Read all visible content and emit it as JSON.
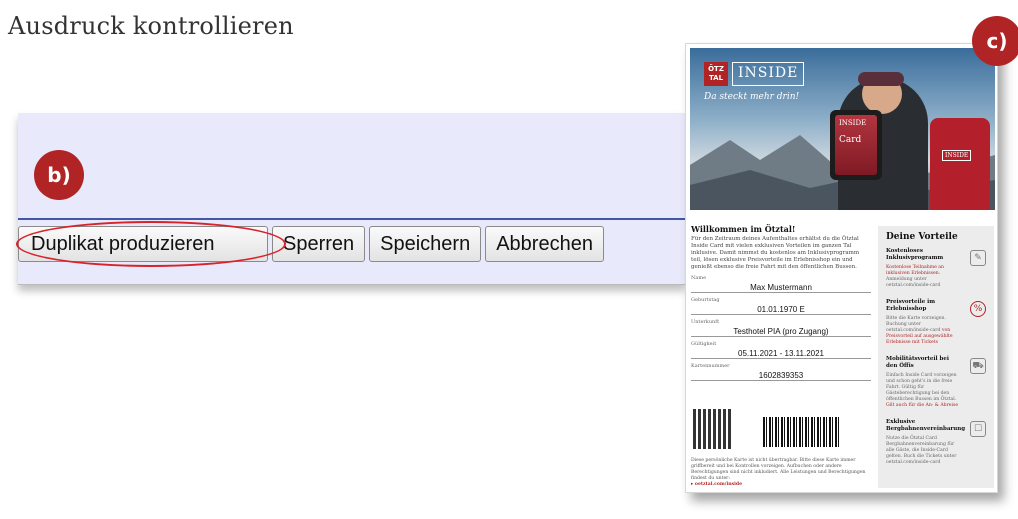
{
  "title": "Ausdruck kontrollieren",
  "badges": {
    "b": "b)",
    "c": "c)"
  },
  "buttons": {
    "duplicate": "Duplikat produzieren",
    "lock": "Sperren",
    "save": "Speichern",
    "cancel": "Abbrechen"
  },
  "colors": {
    "highlight": "#d8232a",
    "badge": "#b02425",
    "panel": "#e8eafb",
    "divider": "#4456a8"
  },
  "card": {
    "logo": "ÖTZ TAL",
    "brand": "INSIDE",
    "tagline": "Da steckt mehr drin!",
    "phone_card_brand": "INSIDE",
    "phone_card_label": "Card",
    "bag_label": "INSIDE",
    "welcome": "Willkommen im Ötztal!",
    "intro": "Für den Zeitraum deines Aufenthaltes erhältst du die Ötztal Inside Card mit vielen exklusiven Vorteilen im ganzen Tal inklusive. Damit nimmst du kostenlos am Inklusivprogramm teil, lösen exklusive Preisvorteile im Erlebnisshop ein und genießt ebenso die freie Fahrt mit den öffentlichen Bussen.",
    "fields": [
      {
        "label": "Name",
        "value": "Max Mustermann"
      },
      {
        "label": "Geburtstag",
        "value": "01.01.1970   E"
      },
      {
        "label": "Unterkunft",
        "value": "Testhotel PIA (pro Zugang)"
      },
      {
        "label": "Gültigkeit",
        "value": "05.11.2021 - 13.11.2021"
      },
      {
        "label": "Kartennummer",
        "value": "1602839353"
      }
    ],
    "footer": "Diese persönliche Karte ist nicht übertragbar. Bitte diese Karte immer griffbereit und bei Kontrollen vorzeigen. Aufbuchen oder andere Berechtigungen sind nicht inkludiert. Alle Leistungen und Berechtigungen findest du unter:",
    "footer_link": "▸ oetztal.com/inside",
    "advantages_title": "Deine Vorteile",
    "advantages": [
      {
        "title": "Kostenloses Inklusivprogramm",
        "desc_red": "Kostenlose Teilnahme an inklusiven Erlebnissen.",
        "desc": "Anmeldung unter oetztal.com/inside-card",
        "icon": "✎"
      },
      {
        "title": "Preisvorteile im Erlebnisshop",
        "desc_red": "von Preisvorteil auf ausgewählte Erlebnisse mit Tickets",
        "desc": "Bitte die Karte vorzeigen. Buchung unter oetztal.com/inside-card",
        "icon": "%"
      },
      {
        "title": "Mobilitätsvorteil bei den Öffis",
        "desc_red": "Gilt auch für die An- & Abreise",
        "desc": "Einfach Inside Card vorzeigen und schon geht's in die freie Fahrt. Gültig für Gästeberechtigung bei den öffentlichen Bussen im Ötztal.",
        "icon": "⛟"
      },
      {
        "title": "Exklusive Bergbahnenvereinbarung",
        "desc_red": "",
        "desc": "Nutze die Ötztal Card Bergbahnenvereinbarung für alle Gäste, die Inside-Card gelten. Buch die Tickets unter oetztal.com/inside-card",
        "icon": "☐"
      }
    ]
  }
}
